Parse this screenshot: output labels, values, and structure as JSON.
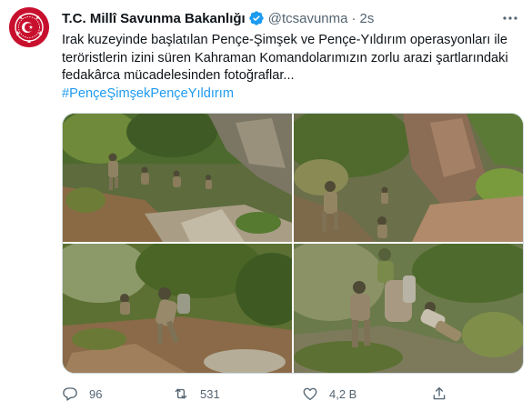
{
  "account": {
    "display_name": "T.C. Millî Savunma Bakanlığı",
    "handle": "@tcsavunma",
    "separator": "·",
    "time": "2s",
    "verified": true
  },
  "tweet": {
    "lines": [
      "Irak kuzeyinde başlatılan Pençe-Şimşek ve Pençe-Yıldırım operasyonları ile",
      "teröristlerin izini süren Kahraman Komandolarımızın zorlu arazi şartlarındaki",
      "fedakârca mücadelesinden fotoğraflar..."
    ],
    "hashtag": "#PençeŞimşekPençeYıldırım"
  },
  "media": {
    "count": 4,
    "photos": [
      {
        "name": "photo-commandos-descending-slope"
      },
      {
        "name": "photo-commando-climbing-rocks"
      },
      {
        "name": "photo-commando-crouching-hillside"
      },
      {
        "name": "photo-commandos-carrying-wounded"
      }
    ]
  },
  "actions": {
    "reply_count": "96",
    "retweet_count": "531",
    "like_count": "4,2 B",
    "reply_icon": "reply-icon",
    "retweet_icon": "retweet-icon",
    "like_icon": "heart-icon",
    "share_icon": "share-icon"
  },
  "colors": {
    "accent": "#1d9bf0",
    "text": "#0f1419",
    "secondary": "#536471",
    "avatar_bg": "#c8102e"
  }
}
